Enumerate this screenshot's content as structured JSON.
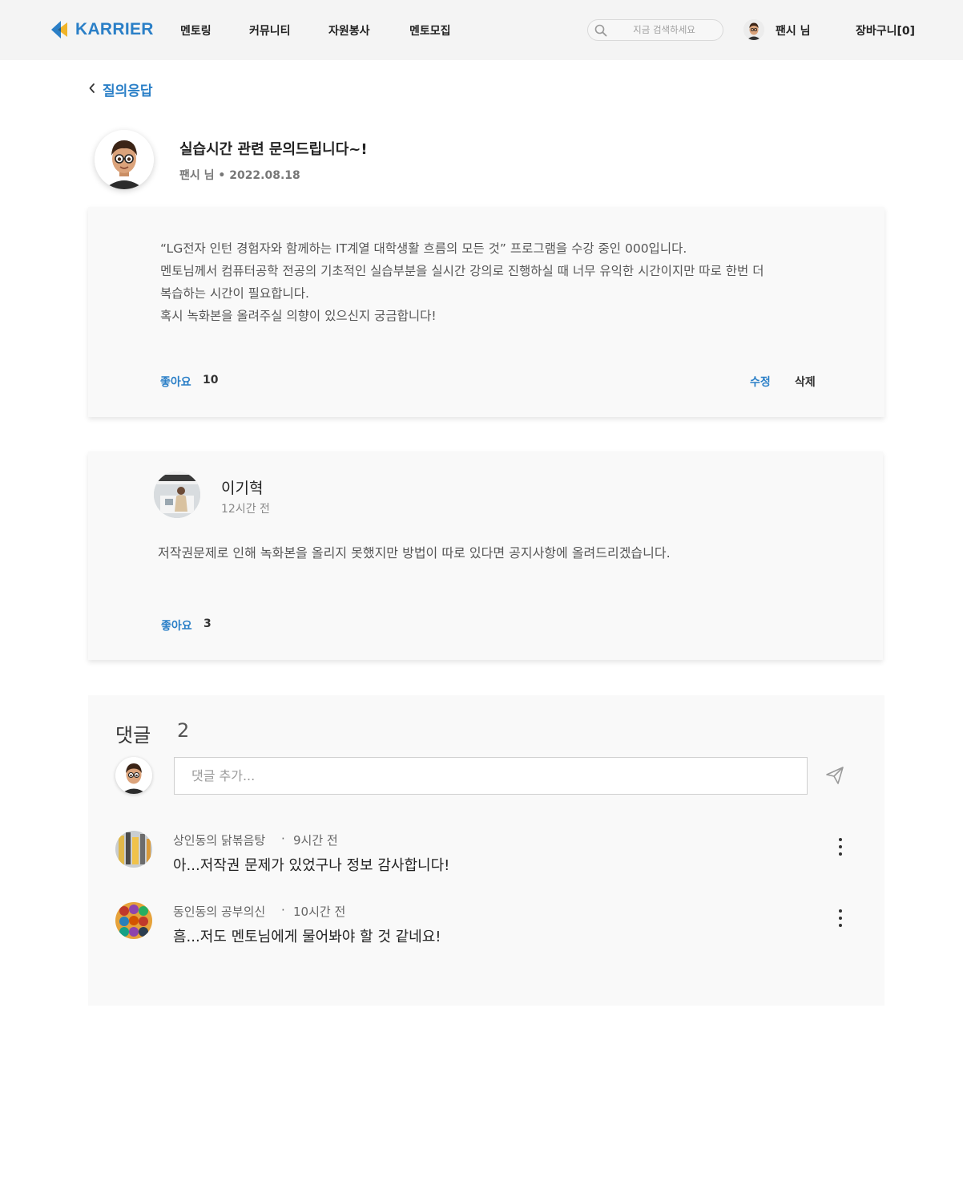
{
  "brand": {
    "logo_text": "KARRIER",
    "accent": "#2a7fc7"
  },
  "nav": {
    "items": [
      {
        "label": "멘토링"
      },
      {
        "label": "커뮤니티"
      },
      {
        "label": "자원봉사"
      },
      {
        "label": "멘토모집"
      }
    ],
    "search_placeholder": "지금 검색하세요",
    "user_label": "팬시 님",
    "cart_label": "장바구니[0]"
  },
  "back": {
    "label": "질의응답",
    "icon": "chevron-left-icon"
  },
  "question": {
    "title": "실습시간 관련 문의드립니다~!",
    "meta": "팬시 님 • 2022.08.18",
    "body_lines": [
      "“LG전자 인턴 경험자와 함께하는 IT계열 대학생활 흐름의 모든 것” 프로그램을 수강 중인 000입니다.",
      "멘토님께서 컴퓨터공학 전공의 기초적인 실습부분을 실시간 강의로 진행하실 때 너무 유익한 시간이지만 따로 한번 더",
      "복습하는 시간이 필요합니다.",
      "혹시 녹화본을 올려주실 의향이 있으신지 궁금합니다!"
    ],
    "like_label": "좋아요",
    "like_count": "10",
    "edit_label": "수정",
    "delete_label": "삭제"
  },
  "answer": {
    "author": "이기혁",
    "time": "12시간 전",
    "body": "저작권문제로 인해 녹화본을 올리지 못했지만 방법이 따로 있다면 공지사항에 올려드리겠습니다.",
    "like_label": "좋아요",
    "like_count": "3"
  },
  "comments": {
    "title": "댓글",
    "count": "2",
    "input_placeholder": "댓글 추가...",
    "items": [
      {
        "author": "상인동의 닭볶음탕",
        "time": "9시간 전",
        "text": "아...저작권 문제가 있었구나 정보 감사합니다!"
      },
      {
        "author": "동인동의 공부의신",
        "time": "10시간 전",
        "text": "흠...저도 멘토님에게 물어봐야 할 것 같네요!"
      }
    ]
  }
}
